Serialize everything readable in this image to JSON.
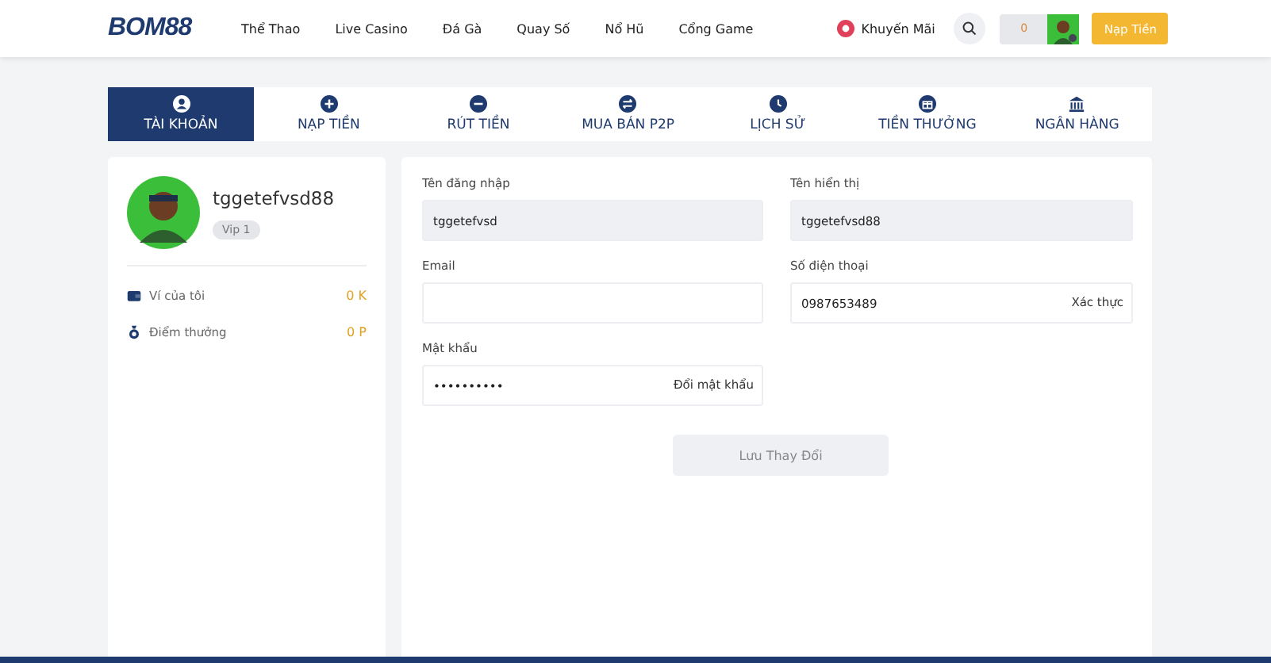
{
  "header": {
    "logo": "BOM88",
    "nav": [
      {
        "label": "Thể Thao"
      },
      {
        "label": "Live Casino"
      },
      {
        "label": "Đá Gà"
      },
      {
        "label": "Quay Số"
      },
      {
        "label": "Nổ Hũ"
      },
      {
        "label": "Cổng Game"
      }
    ],
    "promo": "Khuyến Mãi",
    "balance": "0",
    "deposit": "Nạp Tiền"
  },
  "tabs": [
    {
      "label": "TÀI KHOẢN",
      "selected": true
    },
    {
      "label": "NẠP TIỀN",
      "selected": false
    },
    {
      "label": "RÚT TIỀN",
      "selected": false
    },
    {
      "label": "MUA BÁN P2P",
      "selected": false
    },
    {
      "label": "LỊCH SỬ",
      "selected": false
    },
    {
      "label": "TIỀN THƯỞNG",
      "selected": false
    },
    {
      "label": "NGÂN HÀNG",
      "selected": false
    }
  ],
  "profile": {
    "username": "tggetefvsd88",
    "vip": "Vip 1",
    "stats": [
      {
        "label": "Ví của tôi",
        "value": "0 K"
      },
      {
        "label": "Điểm thưởng",
        "value": "0 P"
      }
    ]
  },
  "form": {
    "fields": [
      {
        "label": "Tên đăng nhập",
        "value": "tggetefvsd",
        "readonly": true
      },
      {
        "label": "Tên hiển thị",
        "value": "tggetefvsd88",
        "readonly": true
      },
      {
        "label": "Email",
        "readonly": false
      },
      {
        "label": "Số điện thoại",
        "value": "0987653489",
        "readonly": false,
        "action": "Xác thực"
      },
      {
        "label": "Mật khẩu",
        "value": "••••••••••",
        "readonly": false,
        "action": "Đổi mật khẩu"
      }
    ],
    "save": "Lưu Thay Đổi"
  }
}
